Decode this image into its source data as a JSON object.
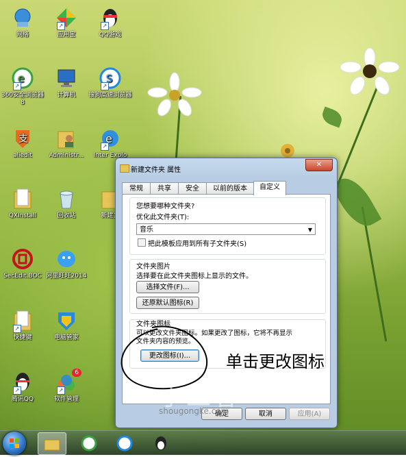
{
  "desktop": {
    "icons": [
      {
        "label": "网络",
        "icon": "network-icon"
      },
      {
        "label": "应用宝",
        "icon": "app-store-icon"
      },
      {
        "label": "QQ游戏",
        "icon": "qq-game-icon"
      },
      {
        "label": "360安全浏览器8",
        "icon": "browser-360-icon"
      },
      {
        "label": "计算机",
        "icon": "computer-icon"
      },
      {
        "label": "搜狗高速浏览器",
        "icon": "sogou-browser-icon"
      },
      {
        "label": "aliedit",
        "icon": "aliedit-icon"
      },
      {
        "label": "Administr...",
        "icon": "user-folder-icon"
      },
      {
        "label": "Inter Explo",
        "icon": "ie-icon"
      },
      {
        "label": "QXInstall",
        "icon": "folder-icon"
      },
      {
        "label": "回收站",
        "icon": "recycle-bin-icon"
      },
      {
        "label": "新建文",
        "icon": "folder-icon"
      },
      {
        "label": "SecEdit.BOC",
        "icon": "boc-icon"
      },
      {
        "label": "阿里旺旺2014",
        "icon": "aliwangwang-icon"
      },
      {
        "label": "快捷键",
        "icon": "folder-icon"
      },
      {
        "label": "电脑管家",
        "icon": "pc-manager-icon"
      },
      {
        "label": "腾讯QQ",
        "icon": "qq-icon"
      },
      {
        "label": "软件管理",
        "icon": "software-manager-icon"
      }
    ],
    "software_badge": "6"
  },
  "dialog": {
    "title": "新建文件夹 属性",
    "close": "✕",
    "tabs": [
      "常规",
      "共享",
      "安全",
      "以前的版本",
      "自定义"
    ],
    "active_tab": "自定义",
    "section1": {
      "heading": "您想要哪种文件夹?",
      "optimize_label": "优化此文件夹(T):",
      "optimize_value": "音乐",
      "apply_subfolders": "把此模板应用到所有子文件夹(S)"
    },
    "section2": {
      "heading": "文件夹图片",
      "description": "选择要在此文件夹图标上显示的文件。",
      "choose_file": "选择文件(F)...",
      "restore_default": "还原默认图标(R)"
    },
    "section3": {
      "heading": "文件夹图标",
      "description_line1": "可以更改文件夹图标。如果更改了图标，它将不再显示",
      "description_line2": "文件夹内容的预览。",
      "change_icon": "更改图标(I)..."
    },
    "buttons": {
      "ok": "确定",
      "cancel": "取消",
      "apply": "应用(A)"
    }
  },
  "annotation": {
    "text": "单击更改图标"
  },
  "watermark": {
    "text": "手工客",
    "sub": "shougongke.com"
  },
  "colors": {
    "accent": "#2a6fc0",
    "close": "#c8462c"
  }
}
